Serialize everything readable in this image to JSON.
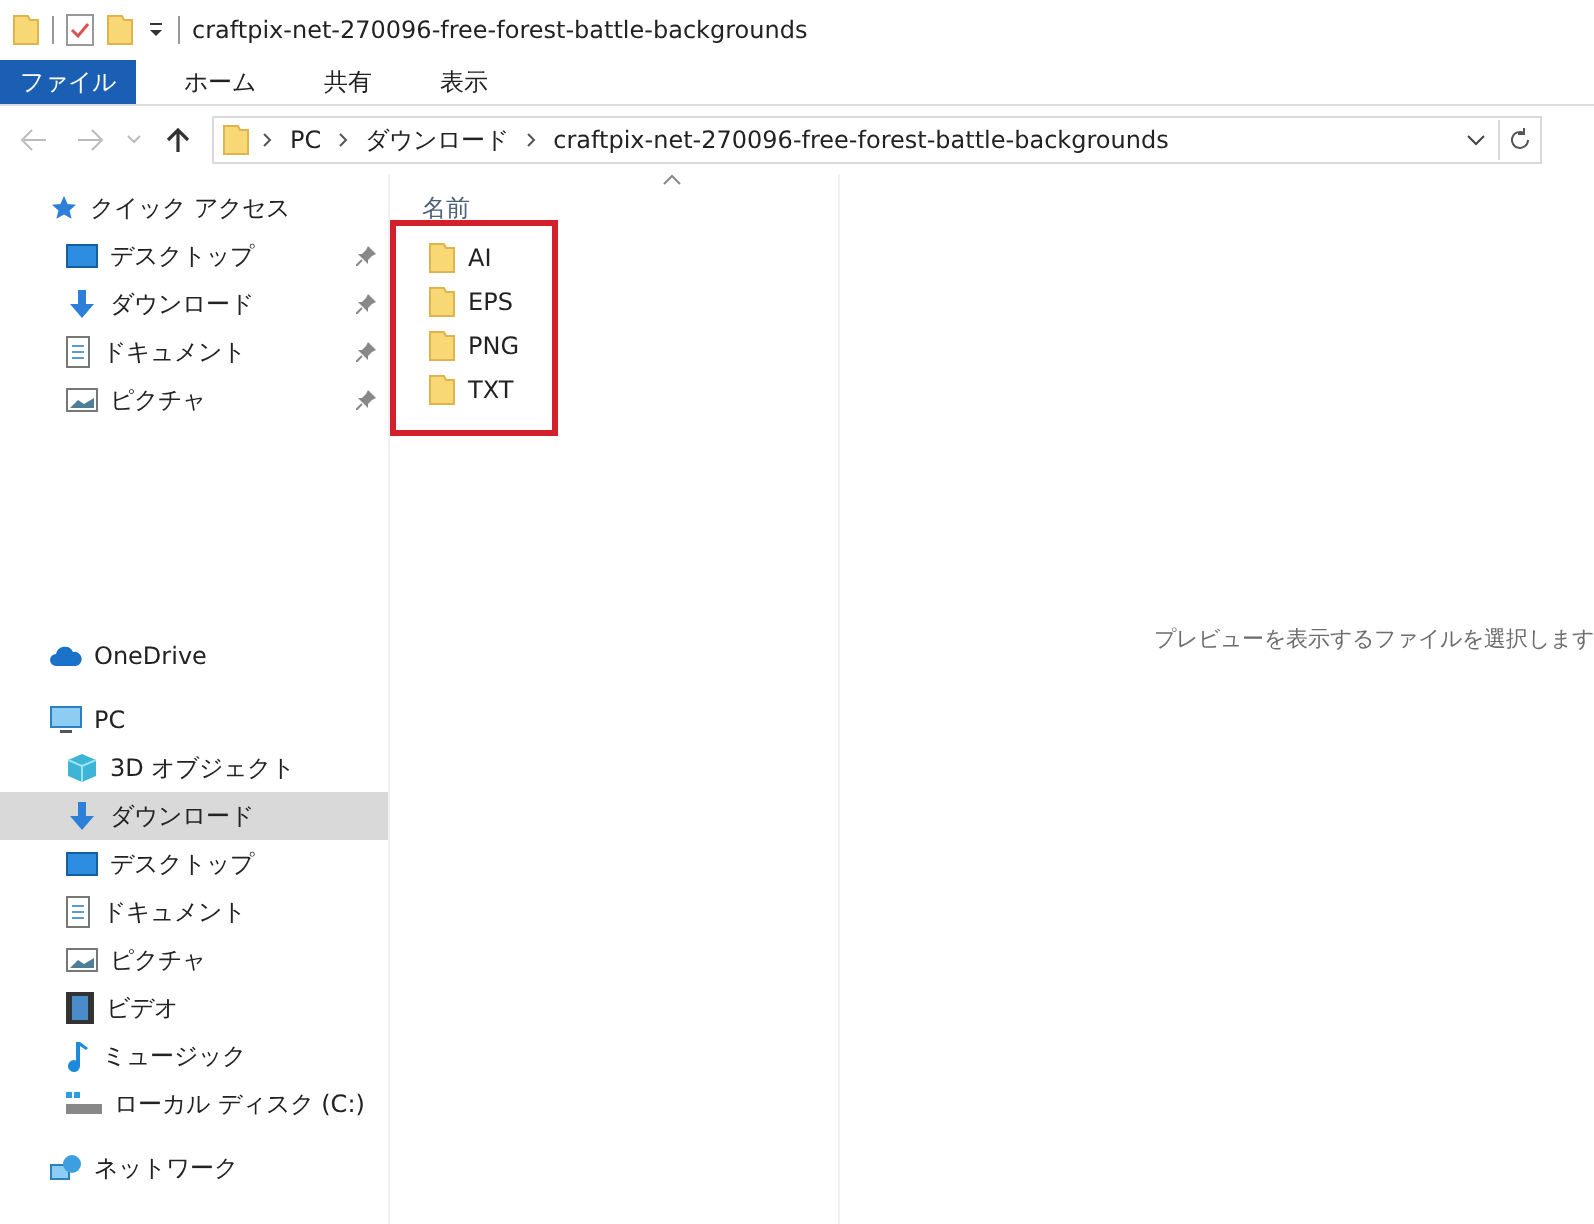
{
  "window": {
    "title": "craftpix-net-270096-free-forest-battle-backgrounds"
  },
  "ribbon_tabs": [
    {
      "label": "ファイル",
      "selected": true
    },
    {
      "label": "ホーム",
      "selected": false
    },
    {
      "label": "共有",
      "selected": false
    },
    {
      "label": "表示",
      "selected": false
    }
  ],
  "address_bar": {
    "crumbs": [
      "PC",
      "ダウンロード",
      "craftpix-net-270096-free-forest-battle-backgrounds"
    ]
  },
  "sidebar": {
    "sections": [
      {
        "label": "クイック アクセス",
        "selected": false,
        "children": [
          {
            "label": "デスクトップ",
            "selected": false,
            "pinned": true
          },
          {
            "label": "ダウンロード",
            "selected": false,
            "pinned": true
          },
          {
            "label": "ドキュメント",
            "selected": false,
            "pinned": true
          },
          {
            "label": "ピクチャ",
            "selected": false,
            "pinned": true
          }
        ]
      },
      {
        "label": "OneDrive",
        "selected": false
      },
      {
        "label": "PC",
        "selected": false,
        "children": [
          {
            "label": "3D オブジェクト",
            "selected": false,
            "pinned": false
          },
          {
            "label": "ダウンロード",
            "selected": true,
            "pinned": false
          },
          {
            "label": "デスクトップ",
            "selected": false,
            "pinned": false
          },
          {
            "label": "ドキュメント",
            "selected": false,
            "pinned": false
          },
          {
            "label": "ピクチャ",
            "selected": false,
            "pinned": false
          },
          {
            "label": "ビデオ",
            "selected": false,
            "pinned": false
          },
          {
            "label": "ミュージック",
            "selected": false,
            "pinned": false
          },
          {
            "label": "ローカル ディスク (C:)",
            "selected": false,
            "pinned": false
          }
        ]
      },
      {
        "label": "ネットワーク",
        "selected": false
      }
    ]
  },
  "file_list": {
    "column": "名前",
    "highlighted": true,
    "items": [
      "AI",
      "EPS",
      "PNG",
      "TXT"
    ]
  },
  "preview_pane": {
    "message": "プレビューを表示するファイルを選択します"
  }
}
